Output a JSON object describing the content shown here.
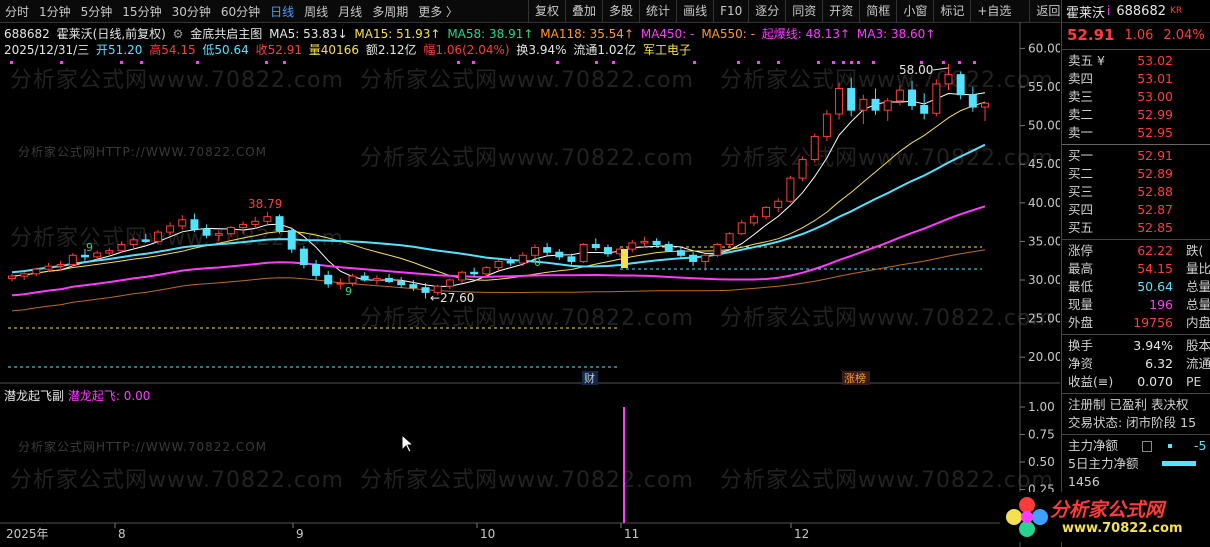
{
  "periods": [
    "分时",
    "1分钟",
    "5分钟",
    "15分钟",
    "30分钟",
    "60分钟",
    "日线",
    "周线",
    "月线",
    "多周期",
    "更多 〉"
  ],
  "active_period": "日线",
  "tools": [
    "复权",
    "叠加",
    "多股",
    "统计",
    "画线",
    "F10",
    "逐分",
    "同资",
    "开资",
    "简框",
    "小窗",
    "标记",
    "+自选",
    "返回"
  ],
  "info_line1": {
    "code": "688682",
    "name": "霍莱沃(日线,前复权)",
    "indicator": "金底共启主图",
    "ma5": "MA5: 53.83↓",
    "ma15": "MA15: 51.93↑",
    "ma58": "MA58: 38.91↑",
    "ma118": "MA118: 35.54↑",
    "ma450": "MA450: -",
    "ma550": "MA550: -",
    "qibaoxian": "起爆线: 48.13↑",
    "ma3": "MA3: 38.60↑"
  },
  "info_line2": {
    "date": "2025/12/31/三",
    "open": "开51.20",
    "high": "高54.15",
    "low": "低50.64",
    "close": "收52.91",
    "volume": "量40166",
    "amount": "额2.12亿",
    "range": "幅1.06(2.04%)",
    "turnover": "换3.94%",
    "float": "流通1.02亿",
    "sector": "军工电子"
  },
  "price_axis": [
    "60.00",
    "55.00",
    "50.00",
    "45.00",
    "40.00",
    "35.00",
    "30.00",
    "25.00",
    "20.00"
  ],
  "vol_axis": [
    "1.00",
    "0.75",
    "0.50",
    "0.25",
    "0.00"
  ],
  "date_axis": [
    "2025年",
    "8",
    "9",
    "10",
    "11",
    "12"
  ],
  "annotations": {
    "high_label": "58.00",
    "high2_label": "38.79",
    "low_label": "27.60",
    "label_9a": "9",
    "label_9b": "9",
    "label_0": "0",
    "cai": "财",
    "zhangbang": "涨榜"
  },
  "sub_title": {
    "name": "潜龙起飞副",
    "value": "潜龙起飞: 0.00"
  },
  "watermarks": {
    "big": "分析家公式网www.70822.com",
    "small": "分析家公式网HTTP://WWW.70822.COM"
  },
  "quote": {
    "name": "霍莱沃",
    "flag": "i",
    "code": "688682",
    "kr": "KR",
    "price": "52.91",
    "change": "1.06",
    "pct": "2.04%",
    "asks": [
      {
        "l": "卖五 ¥",
        "v": "53.02"
      },
      {
        "l": "卖四",
        "v": "53.01"
      },
      {
        "l": "卖三",
        "v": "53.00"
      },
      {
        "l": "卖二",
        "v": "52.99"
      },
      {
        "l": "卖一",
        "v": "52.95"
      }
    ],
    "bids": [
      {
        "l": "买一",
        "v": "52.91"
      },
      {
        "l": "买二",
        "v": "52.89"
      },
      {
        "l": "买三",
        "v": "52.88"
      },
      {
        "l": "买四",
        "v": "52.87"
      },
      {
        "l": "买五",
        "v": "52.85"
      }
    ],
    "stats": [
      {
        "l": "涨停",
        "v": "62.22",
        "c": "red",
        "ex": "跌("
      },
      {
        "l": "最高",
        "v": "54.15",
        "c": "red",
        "ex": "量比"
      },
      {
        "l": "最低",
        "v": "50.64",
        "c": "cyan",
        "ex": "总量"
      },
      {
        "l": "现量",
        "v": "196",
        "c": "mag",
        "ex": "总量"
      },
      {
        "l": "外盘",
        "v": "19756",
        "c": "red",
        "ex": "内盘"
      }
    ],
    "stats2": [
      {
        "l": "换手",
        "v": "3.94%",
        "ex": "股本"
      },
      {
        "l": "净资",
        "v": "6.32",
        "ex": "流通"
      },
      {
        "l": "收益(≡)",
        "v": "0.070",
        "ex": "PE"
      }
    ],
    "tags": "注册制 已盈利 表决权",
    "status": "交易状态: 闭市阶段 15",
    "flow1": "主力净额",
    "flow1v": "-5",
    "flow2": "5日主力净额",
    "partial": "1456"
  },
  "logo": {
    "text": "分析家公式网",
    "url": "www.70822.com"
  },
  "colors": {
    "up": "#ff3b3b",
    "down": "#52e3ff",
    "ma5": "#ffffff",
    "ma15": "#f5e050",
    "ma58": "#ff3bff",
    "ma118": "#ff9a2e",
    "band": "#52e3ff"
  },
  "chart_data": {
    "type": "candlestick",
    "ylim": [
      18,
      62
    ],
    "x_dates": [
      "2025年",
      "8",
      "9",
      "10",
      "11",
      "12"
    ],
    "candles": [
      [
        30.2,
        30.8,
        29.8,
        30.5
      ],
      [
        30.5,
        31.0,
        30.0,
        30.8
      ],
      [
        30.8,
        31.6,
        30.5,
        31.4
      ],
      [
        31.4,
        32.2,
        31.0,
        31.8
      ],
      [
        31.8,
        32.5,
        31.2,
        32.0
      ],
      [
        32.0,
        33.5,
        31.8,
        33.2
      ],
      [
        33.2,
        34.0,
        32.5,
        33.0
      ],
      [
        33.0,
        33.8,
        32.6,
        33.5
      ],
      [
        33.5,
        34.2,
        33.0,
        33.8
      ],
      [
        33.8,
        35.0,
        33.5,
        34.6
      ],
      [
        34.6,
        35.5,
        34.0,
        35.2
      ],
      [
        35.2,
        36.0,
        34.8,
        35.0
      ],
      [
        35.0,
        36.5,
        34.6,
        36.2
      ],
      [
        36.2,
        37.5,
        35.8,
        37.0
      ],
      [
        37.0,
        38.4,
        36.5,
        37.8
      ],
      [
        37.8,
        38.6,
        36.2,
        36.6
      ],
      [
        36.6,
        37.2,
        35.4,
        35.8
      ],
      [
        35.8,
        36.4,
        35.0,
        36.0
      ],
      [
        36.0,
        37.0,
        35.6,
        36.8
      ],
      [
        36.8,
        37.6,
        36.0,
        37.2
      ],
      [
        37.2,
        38.2,
        36.6,
        37.6
      ],
      [
        37.6,
        38.79,
        37.0,
        38.2
      ],
      [
        38.2,
        38.5,
        36.0,
        36.4
      ],
      [
        36.4,
        36.8,
        33.5,
        34.0
      ],
      [
        34.0,
        34.4,
        31.5,
        32.0
      ],
      [
        32.0,
        32.6,
        30.0,
        30.6
      ],
      [
        30.6,
        31.2,
        29.0,
        29.5
      ],
      [
        29.5,
        30.2,
        28.8,
        29.6
      ],
      [
        29.6,
        30.8,
        29.2,
        30.5
      ],
      [
        30.5,
        31.0,
        29.8,
        30.0
      ],
      [
        30.0,
        30.6,
        29.4,
        30.2
      ],
      [
        30.2,
        30.8,
        29.6,
        29.8
      ],
      [
        29.8,
        30.4,
        29.0,
        29.4
      ],
      [
        29.4,
        30.0,
        28.6,
        29.0
      ],
      [
        29.0,
        29.6,
        27.6,
        28.4
      ],
      [
        28.4,
        29.4,
        28.0,
        29.2
      ],
      [
        29.2,
        30.2,
        28.8,
        30.0
      ],
      [
        30.0,
        31.2,
        29.6,
        31.0
      ],
      [
        31.0,
        31.6,
        30.4,
        30.8
      ],
      [
        30.8,
        31.8,
        30.4,
        31.6
      ],
      [
        31.6,
        32.6,
        31.2,
        32.4
      ],
      [
        32.4,
        33.0,
        31.8,
        32.2
      ],
      [
        32.2,
        33.6,
        31.8,
        33.2
      ],
      [
        33.2,
        34.6,
        32.8,
        34.2
      ],
      [
        34.2,
        34.8,
        33.2,
        33.6
      ],
      [
        33.6,
        34.0,
        32.6,
        33.0
      ],
      [
        33.0,
        33.4,
        32.0,
        32.4
      ],
      [
        32.4,
        34.8,
        32.2,
        34.6
      ],
      [
        34.6,
        35.4,
        33.8,
        34.2
      ],
      [
        34.2,
        34.6,
        33.0,
        33.4
      ],
      [
        33.4,
        34.2,
        33.0,
        34.0
      ],
      [
        34.0,
        35.2,
        33.6,
        34.8
      ],
      [
        34.8,
        35.6,
        34.2,
        35.0
      ],
      [
        35.0,
        35.4,
        34.2,
        34.6
      ],
      [
        34.6,
        35.0,
        33.6,
        33.8
      ],
      [
        33.8,
        34.2,
        32.8,
        33.2
      ],
      [
        33.2,
        33.6,
        31.8,
        32.4
      ],
      [
        32.4,
        33.4,
        31.2,
        33.2
      ],
      [
        33.2,
        34.8,
        33.0,
        34.6
      ],
      [
        34.6,
        36.2,
        34.4,
        36.0
      ],
      [
        36.0,
        37.8,
        35.8,
        37.4
      ],
      [
        37.4,
        38.6,
        37.0,
        38.2
      ],
      [
        38.2,
        39.6,
        37.8,
        39.4
      ],
      [
        39.4,
        40.6,
        38.8,
        40.2
      ],
      [
        40.2,
        43.5,
        40.0,
        43.2
      ],
      [
        43.2,
        46.0,
        42.8,
        45.6
      ],
      [
        45.6,
        49.0,
        45.2,
        48.6
      ],
      [
        48.6,
        52.0,
        48.0,
        51.5
      ],
      [
        51.5,
        55.6,
        50.8,
        54.8
      ],
      [
        54.8,
        56.2,
        51.2,
        52.0
      ],
      [
        52.0,
        54.0,
        50.2,
        53.4
      ],
      [
        53.4,
        54.8,
        51.4,
        52.0
      ],
      [
        52.0,
        53.6,
        50.6,
        53.2
      ],
      [
        53.2,
        55.2,
        52.6,
        54.6
      ],
      [
        54.6,
        55.8,
        52.0,
        52.6
      ],
      [
        52.6,
        54.2,
        50.8,
        51.6
      ],
      [
        51.6,
        56.0,
        51.2,
        55.4
      ],
      [
        55.4,
        58.0,
        54.6,
        56.6
      ],
      [
        56.6,
        57.0,
        53.4,
        54.0
      ],
      [
        54.0,
        55.0,
        51.8,
        52.4
      ],
      [
        52.4,
        53.0,
        50.6,
        52.9
      ]
    ]
  }
}
